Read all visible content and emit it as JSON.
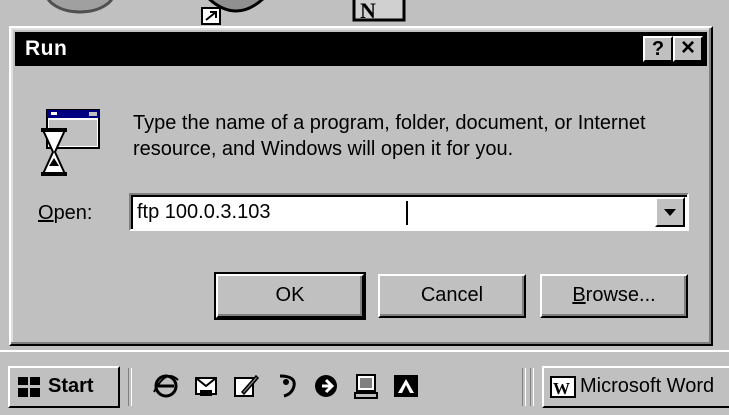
{
  "dialog": {
    "title": "Run",
    "help_label": "?",
    "close_label": "×",
    "description": "Type the name of a program, folder, document, or Internet resource, and Windows will open it for you.",
    "open_label_accel": "O",
    "open_label_rest": "pen:",
    "open_value": "ftp 100.0.3.103",
    "buttons": {
      "ok": "OK",
      "cancel": "Cancel",
      "browse_accel": "B",
      "browse_rest": "rowse..."
    }
  },
  "taskbar": {
    "start_label": "Start",
    "quick_launch": [
      "ie-icon",
      "outlook-icon",
      "notepad-icon",
      "pen-icon",
      "realplayer-icon",
      "monitor-icon",
      "paint-icon"
    ],
    "tasks": [
      {
        "label": "Microsoft Word",
        "icon": "word-icon"
      }
    ]
  },
  "colors": {
    "face": "#c0c0c0",
    "titlebar": "#000000",
    "title_text": "#ffffff"
  }
}
